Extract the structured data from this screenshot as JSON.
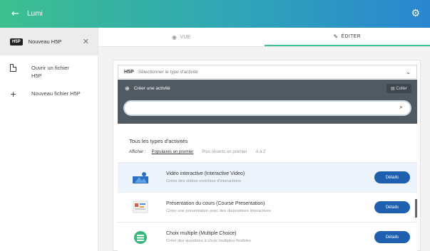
{
  "app": {
    "title": "Lumi"
  },
  "sidebar": {
    "tab": {
      "badge": "H5P",
      "label": "Nouveau H5P"
    },
    "items": [
      {
        "icon": "file-icon",
        "label": "Ouvrir un fichier H5P"
      },
      {
        "icon": "plus-icon",
        "label": "Nouveau fichier H5P"
      }
    ]
  },
  "view_tabs": [
    {
      "icon": "eye-icon",
      "label": "VUE",
      "active": false
    },
    {
      "icon": "pencil-icon",
      "label": "ÉDITER",
      "active": true
    }
  ],
  "editor": {
    "logo": "H5P",
    "selector_placeholder": "Sélectionner le type d'activité",
    "hub_title": "Créer une activité",
    "paste_label": "Coller",
    "search_placeholder": "",
    "types_title": "Tous les types d'activités",
    "filter_label": "Afficher :",
    "filters": [
      {
        "label": "Populaires en premier",
        "active": true
      },
      {
        "label": "Plus récents en premier",
        "active": false
      },
      {
        "label": "A à Z",
        "active": false
      }
    ],
    "content_types": [
      {
        "name": "Vidéo interactive (Interactive Video)",
        "description": "Créez des vidéos enrichies d'interactions",
        "button": "Détails",
        "highlight": true
      },
      {
        "name": "Présentation du cours (Course Presentation)",
        "description": "Créer une présentation avec des diapositives interactives",
        "button": "Détails",
        "highlight": false
      },
      {
        "name": "Choix multiple (Multiple Choice)",
        "description": "Créer des questions à choix multiples flexibles",
        "button": "Détails",
        "highlight": false
      }
    ]
  },
  "colors": {
    "accent": "#3dbf8f",
    "button": "#1f5fb0",
    "hub_header": "#505a63"
  }
}
